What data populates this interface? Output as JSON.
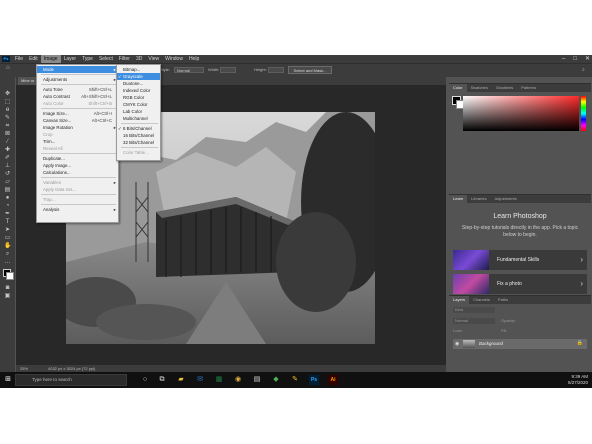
{
  "menubar": {
    "logo": "Ps",
    "items": [
      "File",
      "Edit",
      "Image",
      "Layer",
      "Type",
      "Select",
      "Filter",
      "3D",
      "View",
      "Window",
      "Help"
    ],
    "active_index": 2,
    "window_controls": [
      "–",
      "□",
      "✕"
    ]
  },
  "options_bar": {
    "style_label": "Style:",
    "style_value": "Normal",
    "width_label": "Width:",
    "height_label": "Height:",
    "select_mask_button": "Select and Mask..."
  },
  "document": {
    "tab_label": "Mine or",
    "zoom": "25%",
    "doc_info": "4032 px x 3024 px (72 ppi)"
  },
  "image_menu": {
    "rows": [
      {
        "label": "Mode",
        "shortcut": "",
        "submenu": true,
        "disabled": false,
        "highlighted": true
      },
      {
        "sep": true
      },
      {
        "label": "Adjustments",
        "shortcut": "",
        "submenu": true,
        "disabled": false
      },
      {
        "sep": true
      },
      {
        "label": "Auto Tone",
        "shortcut": "Shift+Ctrl+L",
        "disabled": false
      },
      {
        "label": "Auto Contrast",
        "shortcut": "Alt+Shift+Ctrl+L",
        "disabled": false
      },
      {
        "label": "Auto Color",
        "shortcut": "Shift+Ctrl+B",
        "disabled": true
      },
      {
        "sep": true
      },
      {
        "label": "Image Size...",
        "shortcut": "Alt+Ctrl+I",
        "disabled": false
      },
      {
        "label": "Canvas Size...",
        "shortcut": "Alt+Ctrl+C",
        "disabled": false
      },
      {
        "label": "Image Rotation",
        "shortcut": "",
        "submenu": true,
        "disabled": false
      },
      {
        "label": "Crop",
        "shortcut": "",
        "disabled": true
      },
      {
        "label": "Trim...",
        "shortcut": "",
        "disabled": false
      },
      {
        "label": "Reveal All",
        "shortcut": "",
        "disabled": true
      },
      {
        "sep": true
      },
      {
        "label": "Duplicate...",
        "shortcut": "",
        "disabled": false
      },
      {
        "label": "Apply Image...",
        "shortcut": "",
        "disabled": false
      },
      {
        "label": "Calculations...",
        "shortcut": "",
        "disabled": false
      },
      {
        "sep": true
      },
      {
        "label": "Variables",
        "shortcut": "",
        "submenu": true,
        "disabled": true
      },
      {
        "label": "Apply Data Set...",
        "shortcut": "",
        "disabled": true
      },
      {
        "sep": true
      },
      {
        "label": "Trap...",
        "shortcut": "",
        "disabled": true
      },
      {
        "sep": true
      },
      {
        "label": "Analysis",
        "shortcut": "",
        "submenu": true,
        "disabled": false
      }
    ]
  },
  "mode_submenu": {
    "rows": [
      {
        "label": "Bitmap...",
        "disabled": false
      },
      {
        "label": "Grayscale",
        "checked": true,
        "highlighted": true
      },
      {
        "label": "Duotone...",
        "disabled": false
      },
      {
        "label": "Indexed Color",
        "disabled": false
      },
      {
        "label": "RGB Color",
        "disabled": false
      },
      {
        "label": "CMYK Color",
        "disabled": false
      },
      {
        "label": "Lab Color",
        "disabled": false
      },
      {
        "label": "Multichannel",
        "disabled": false
      },
      {
        "sep": true
      },
      {
        "label": "8 Bits/Channel",
        "checked": true
      },
      {
        "label": "16 Bits/Channel",
        "disabled": false
      },
      {
        "label": "32 Bits/Channel",
        "disabled": false
      },
      {
        "sep": true
      },
      {
        "label": "Color Table...",
        "disabled": true
      }
    ]
  },
  "color_panel": {
    "tabs": [
      "Color",
      "Swatches",
      "Gradients",
      "Patterns"
    ],
    "accent_hue": "#ff2a2a"
  },
  "learn_panel": {
    "tabs": [
      "Learn",
      "Libraries",
      "Adjustments"
    ],
    "title": "Learn Photoshop",
    "subtitle": "Step-by-step tutorials directly in the app. Pick a topic below to begin.",
    "cards": [
      {
        "label": "Fundamental Skills"
      },
      {
        "label": "Fix a photo"
      }
    ]
  },
  "layers_panel": {
    "tabs": [
      "Layers",
      "Channels",
      "Paths"
    ],
    "kind_label": "Kind",
    "blend_mode": "Normal",
    "opacity_label": "Opacity:",
    "fill_label": "Fill:",
    "lock_label": "Lock:",
    "layer_name": "Background"
  },
  "taskbar": {
    "search_placeholder": "Type here to search",
    "time": "9:39 AM",
    "date": "5/27/2020"
  }
}
